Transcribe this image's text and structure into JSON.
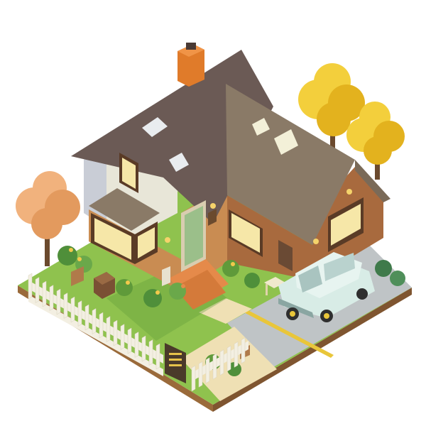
{
  "scene": {
    "subject": "isometric-house-diorama",
    "background_color": "#ffffff"
  },
  "palette": {
    "roof_dark": "#6b5a55",
    "roof_light": "#8a7a67",
    "brick_left": "#c98c52",
    "brick_right": "#a86a3e",
    "siding": "#e8e6d8",
    "siding_shadow": "#c9cdd6",
    "chimney": "#e07b2a",
    "door": "#9bbf8a",
    "window_glass": "#f6e7a8",
    "window_frame": "#5a3b26",
    "grass": "#8fc24e",
    "grass_dark": "#5f9a3a",
    "driveway": "#bfc4c6",
    "soil_edge": "#9a6a3a",
    "fence": "#f3efe2",
    "car_body": "#d8ece6",
    "car_trim": "#8aa6a2",
    "tree_yellow": "#f3cf3c",
    "tree_yellow_shade": "#e3b21e",
    "tree_peach": "#f1b27d",
    "tree_peach_shade": "#e39a5e",
    "path_tile": "#efe0b4",
    "step": "#e58a4a",
    "sign_board": "#4a3a2a",
    "sign_text": "#e6c24a"
  },
  "icons": {
    "chimney": "chimney-icon",
    "skylight": "skylight-icon",
    "lamp": "wall-lamp-icon",
    "mailbox": "mailbox-icon",
    "bucket": "bucket-icon"
  }
}
